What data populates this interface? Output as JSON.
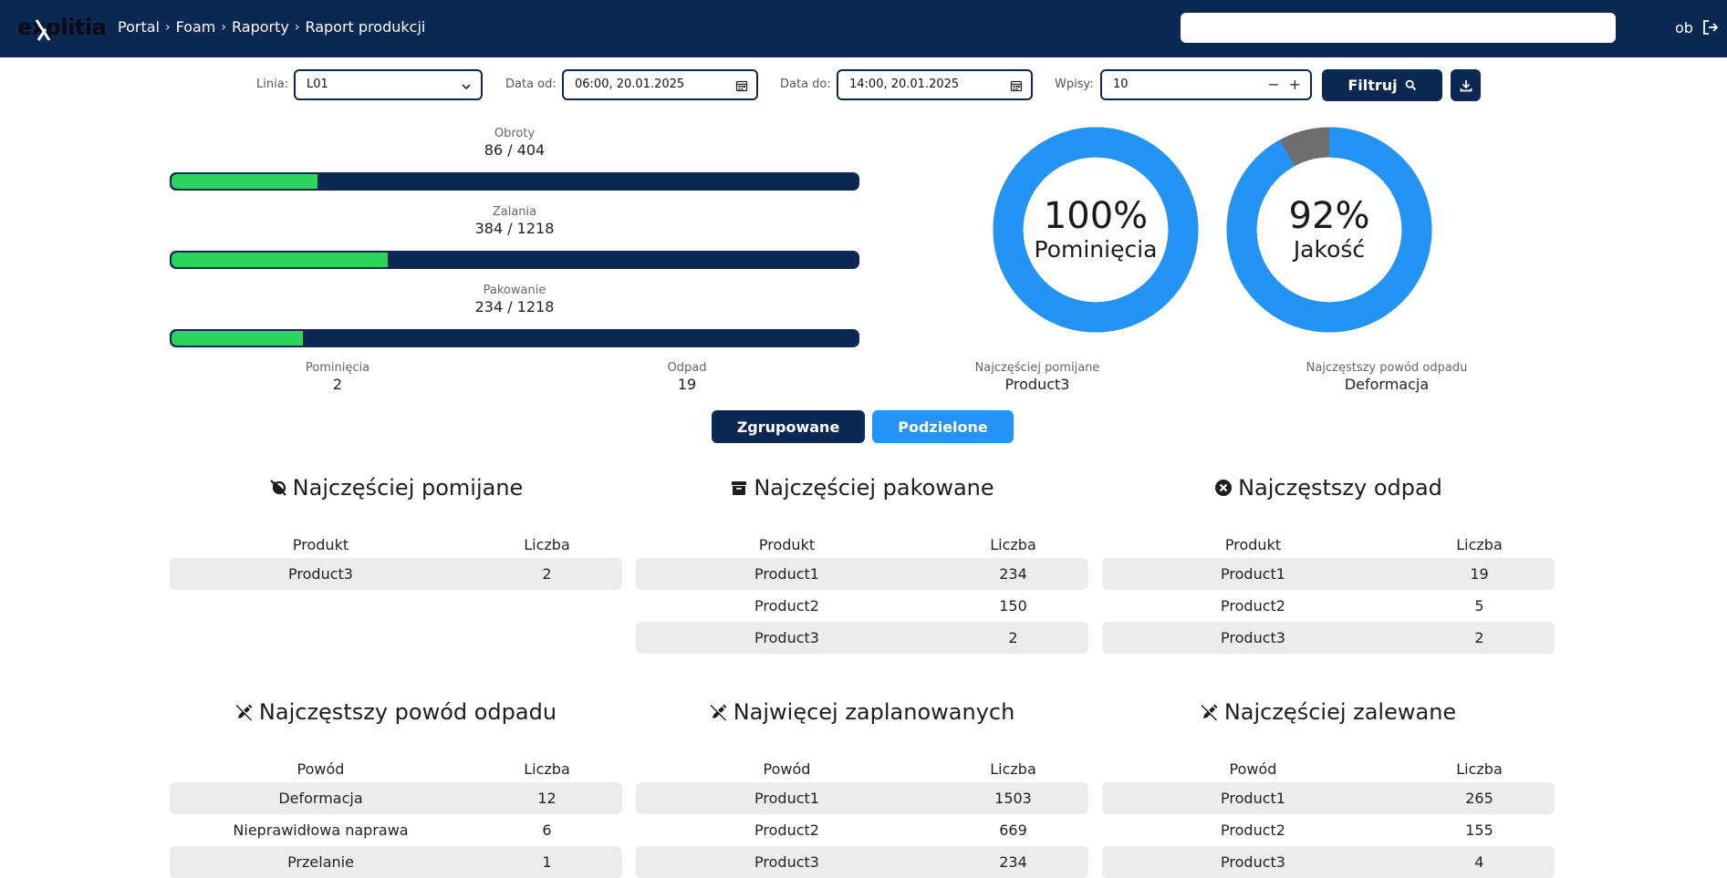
{
  "header": {
    "logo_text": "explitia",
    "breadcrumb": [
      "Portal",
      "Foam",
      "Raporty",
      "Raport produkcji"
    ],
    "user": "ob"
  },
  "filters": {
    "line_label": "Linia:",
    "line_value": "L01",
    "from_label": "Data od:",
    "from_value": "06:00, 20.01.2025",
    "to_label": "Data do:",
    "to_value": "14:00, 20.01.2025",
    "entries_label": "Wpisy:",
    "entries_value": "10",
    "filter_button": "Filtruj"
  },
  "progress": [
    {
      "title": "Obroty",
      "value_text": "86 / 404",
      "fraction": 0.213
    },
    {
      "title": "Zalania",
      "value_text": "384 / 1218",
      "fraction": 0.315
    },
    {
      "title": "Pakowanie",
      "value_text": "234 / 1218",
      "fraction": 0.192
    }
  ],
  "stats": [
    {
      "title": "Pominięcia",
      "value": "2"
    },
    {
      "title": "Odpad",
      "value": "19"
    },
    {
      "title": "Najczęściej pomijane",
      "value": "Product3"
    },
    {
      "title": "Najczęstszy powód odpadu",
      "value": "Deformacja"
    }
  ],
  "donuts": [
    {
      "percent_text": "100%",
      "label": "Pominięcia",
      "fraction": 1.0,
      "color": "#2394f5",
      "rest_color": "#6e6e6e"
    },
    {
      "percent_text": "92%",
      "label": "Jakość",
      "fraction": 0.92,
      "color": "#2394f5",
      "rest_color": "#6e6e6e"
    }
  ],
  "toggle": {
    "grouped": "Zgrupowane",
    "split": "Podzielone"
  },
  "panels": [
    {
      "title": "Najczęściej pomijane",
      "icon": "skip-icon",
      "col1": "Produkt",
      "col2": "Liczba",
      "rows": [
        [
          "Product3",
          "2"
        ]
      ]
    },
    {
      "title": "Najczęściej pakowane",
      "icon": "archive-icon",
      "col1": "Produkt",
      "col2": "Liczba",
      "rows": [
        [
          "Product1",
          "234"
        ],
        [
          "Product2",
          "150"
        ],
        [
          "Product3",
          "2"
        ]
      ]
    },
    {
      "title": "Najczęstszy odpad",
      "icon": "x-circle-icon",
      "col1": "Produkt",
      "col2": "Liczba",
      "rows": [
        [
          "Product1",
          "19"
        ],
        [
          "Product2",
          "5"
        ],
        [
          "Product3",
          "2"
        ]
      ]
    },
    {
      "title": "Najczęstszy powód odpadu",
      "icon": "edit-icon",
      "col1": "Powód",
      "col2": "Liczba",
      "rows": [
        [
          "Deformacja",
          "12"
        ],
        [
          "Nieprawidłowa naprawa",
          "6"
        ],
        [
          "Przelanie",
          "1"
        ]
      ]
    },
    {
      "title": "Najwięcej zaplanowanych",
      "icon": "edit-icon",
      "col1": "Powód",
      "col2": "Liczba",
      "rows": [
        [
          "Product1",
          "1503"
        ],
        [
          "Product2",
          "669"
        ],
        [
          "Product3",
          "234"
        ]
      ]
    },
    {
      "title": "Najczęściej zalewane",
      "icon": "edit-icon",
      "col1": "Powód",
      "col2": "Liczba",
      "rows": [
        [
          "Product1",
          "265"
        ],
        [
          "Product2",
          "155"
        ],
        [
          "Product3",
          "4"
        ]
      ]
    }
  ]
}
